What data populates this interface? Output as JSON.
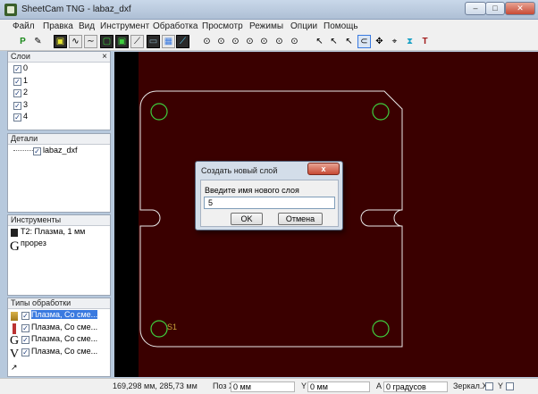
{
  "window": {
    "title": "SheetCam TNG - labaz_dxf"
  },
  "menu": [
    "Файл",
    "Правка",
    "Вид",
    "Инструмент",
    "Обработка",
    "Просмотр",
    "Режимы",
    "Опции",
    "Помощь"
  ],
  "panels": {
    "layers": {
      "title": "Слои",
      "close": "×",
      "items": [
        "0",
        "1",
        "2",
        "3",
        "4"
      ]
    },
    "details": {
      "title": "Детали",
      "items": [
        "labaz_dxf"
      ]
    },
    "tools": {
      "title": "Инструменты",
      "items": [
        "T2: Плазма, 1 мм прорез"
      ]
    },
    "operations": {
      "title": "Типы обработки",
      "items": [
        "Плазма, Со сме...",
        "Плазма, Со сме...",
        "Плазма, Со сме...",
        "Плазма, Со сме..."
      ]
    }
  },
  "canvas": {
    "start_label": "S1"
  },
  "dialog": {
    "title": "Создать новый слой",
    "close": "x",
    "prompt": "Введите имя нового слоя",
    "input_value": "5",
    "ok_label": "OK",
    "cancel_label": "Отмена"
  },
  "status": {
    "coords": "169,298 мм, 285,73 мм",
    "pos_x_label": "Поз X",
    "pos_x_value": "0 мм",
    "y_label": "Y",
    "y_value": "0 мм",
    "angle_label": "A",
    "angle_value": "0 градусов",
    "mirror_x_label": "Зеркал.X",
    "mirror_y_label": "Y"
  },
  "colors": {
    "canvas_bg": "#3a0000",
    "outline": "#e8e8e8",
    "hole": "#3ecf3e",
    "dialog_bg": "#d3dde9"
  }
}
